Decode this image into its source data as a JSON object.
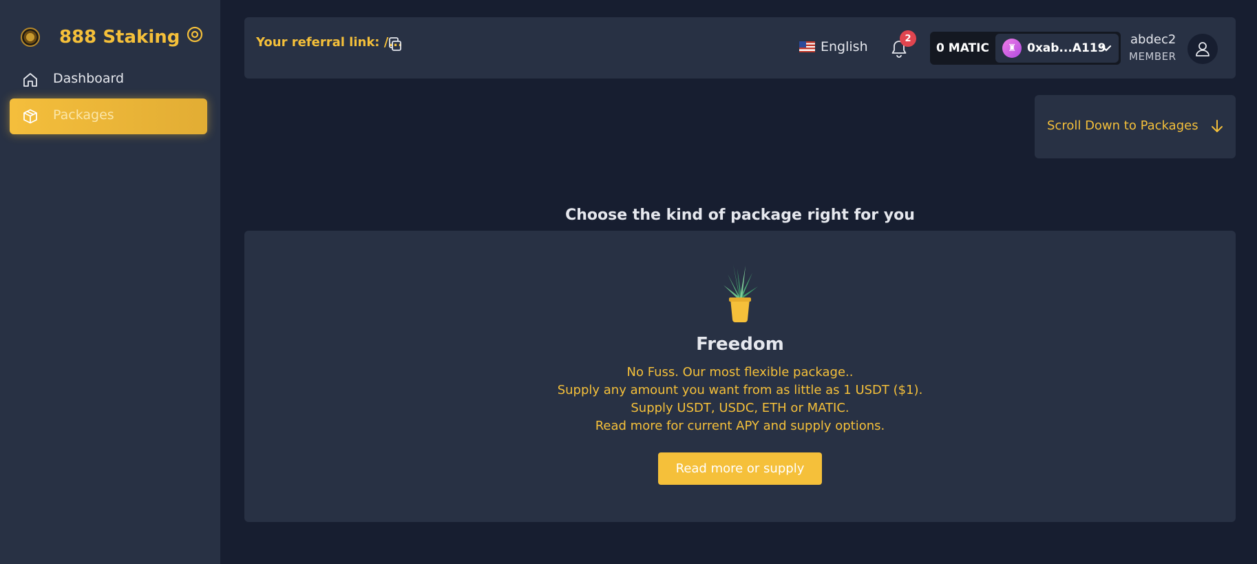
{
  "sidebar": {
    "brand": "888 Staking",
    "items": [
      {
        "label": "Dashboard",
        "icon": "home-icon"
      },
      {
        "label": "Packages",
        "icon": "box-icon",
        "active": true
      }
    ]
  },
  "header": {
    "referral_label": "Your referral link: /...",
    "language": "English",
    "notification_count": "2",
    "balance": "0 MATIC",
    "account_address": "0xab...A119",
    "user_name": "abdec2",
    "user_role": "MEMBER"
  },
  "scroll_card": {
    "label": "Scroll Down to Packages"
  },
  "main": {
    "section_title": "Choose the kind of package right for you",
    "package": {
      "name": "Freedom",
      "description": [
        "No Fuss. Our most flexible package..",
        "Supply any amount you want from as little as 1 USDT ($1).",
        "Supply USDT, USDC, ETH or MATIC.",
        "Read more for current APY and supply options."
      ],
      "button_label": "Read more or supply"
    }
  },
  "colors": {
    "accent": "#f5c03a",
    "background": "#171e30",
    "panel": "#283144",
    "badge": "#e0454f"
  }
}
